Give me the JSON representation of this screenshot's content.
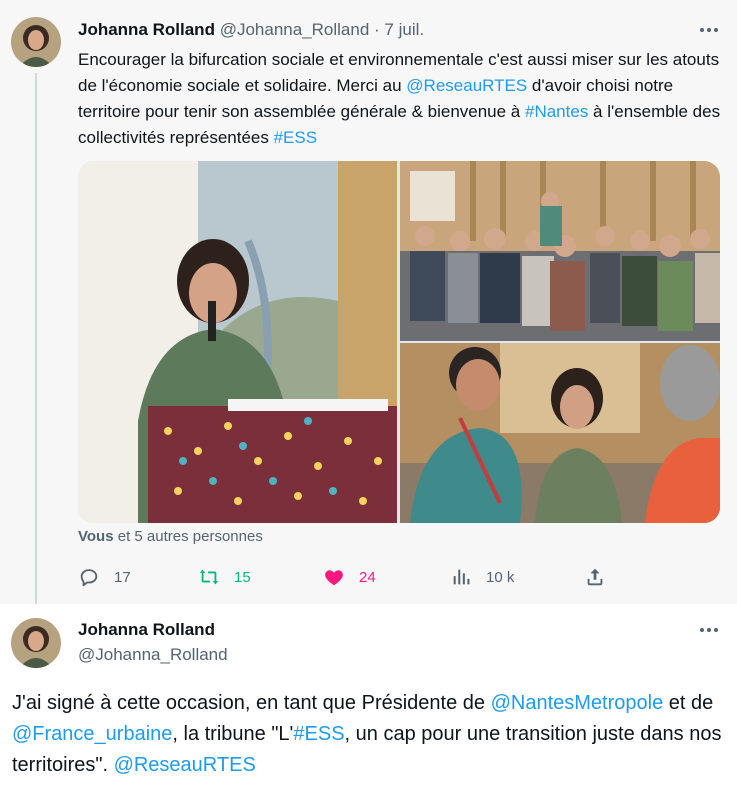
{
  "tweet1": {
    "author_name": "Johanna Rolland",
    "author_handle": "@Johanna_Rolland",
    "separator": " · ",
    "time": "7 juil.",
    "text": {
      "p1": "Encourager la bifurcation sociale et environnementale c'est aussi miser sur les atouts de l'économie sociale et solidaire. Merci au ",
      "mention1": "@ReseauRTES",
      "p2": " d'avoir choisi notre territoire pour tenir son assemblée générale & bienvenue à ",
      "hashtag1": "#Nantes",
      "p3": " à l'ensemble des collectivités représentées ",
      "hashtag2": "#ESS"
    },
    "tagged": {
      "bold": "Vous",
      "rest": " et 5 autres personnes"
    },
    "stats": {
      "replies": "17",
      "retweets": "15",
      "likes": "24",
      "views": "10 k"
    }
  },
  "tweet2": {
    "author_name": "Johanna Rolland",
    "author_handle": "@Johanna_Rolland",
    "text": {
      "p1": "J'ai signé à cette occasion, en tant que Présidente de ",
      "mention1": "@NantesMetropole",
      "p2": " et de ",
      "mention2": "@France_urbaine",
      "p3": ", la tribune \"L'",
      "hashtag1": "#ESS",
      "p4": ", un cap pour une transition juste dans nos territoires\". ",
      "mention3": "@ReseauRTES"
    }
  },
  "colors": {
    "link": "#1d9bf0",
    "retweet": "#00ba7c",
    "like": "#f91880",
    "muted": "#536471"
  },
  "icons": [
    "more-icon",
    "reply-icon",
    "retweet-icon",
    "like-icon",
    "views-icon",
    "share-icon"
  ]
}
